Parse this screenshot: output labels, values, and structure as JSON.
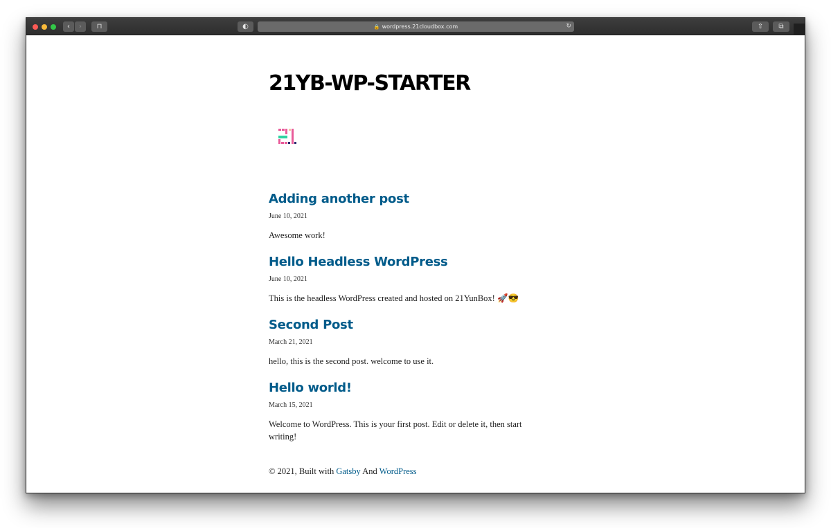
{
  "browser": {
    "url": "wordpress.21cloudbox.com",
    "back_icon": "‹",
    "forward_icon": "›",
    "sidebar_icon": "⊓",
    "shield_icon": "◐",
    "lock_icon": "🔒",
    "reload_icon": "↻",
    "share_icon": "⇧",
    "tabs_icon": "⧉"
  },
  "site": {
    "title": "21YB-WP-STARTER",
    "logo_colors": {
      "pink": "#e95b9a",
      "green": "#2fd3a0",
      "peach": "#f3c9a5",
      "navy": "#2a2a6e"
    }
  },
  "posts": [
    {
      "title": "Adding another post",
      "date": "June 10, 2021",
      "excerpt": "Awesome work!"
    },
    {
      "title": "Hello Headless WordPress",
      "date": "June 10, 2021",
      "excerpt": "This is the headless WordPress created and hosted on 21YunBox! 🚀😎"
    },
    {
      "title": "Second Post",
      "date": "March 21, 2021",
      "excerpt": "hello, this is the second post. welcome to use it."
    },
    {
      "title": "Hello world!",
      "date": "March 15, 2021",
      "excerpt": "Welcome to WordPress. This is your first post. Edit or delete it, then start writing!"
    }
  ],
  "footer": {
    "prefix": "© 2021, Built with ",
    "gatsby_link": "Gatsby",
    "middle": " And ",
    "wordpress_link": "WordPress"
  },
  "colors": {
    "link": "#005b8a",
    "toolbar": "#333333"
  }
}
